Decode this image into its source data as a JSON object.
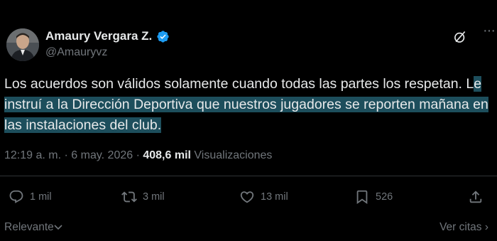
{
  "author": {
    "name": "Amaury Vergara Z.",
    "handle": "@Amauryvz"
  },
  "tweet": {
    "text_before": "Los acuerdos son válidos solamente cuando todas las partes los respetan. L",
    "text_highlight": "e instruí a la Dirección Deportiva que nuestros jugadores se reporten mañana en las instalaciones del club."
  },
  "meta": {
    "timestamp": "12:19 a. m. · 6 may. 2026 · ",
    "views_count": "408,6 mil",
    "views_label": "Visualizaciones"
  },
  "actions": {
    "replies": "1 mil",
    "reposts": "3 mil",
    "likes": "13 mil",
    "bookmarks": "526"
  },
  "footer": {
    "sort_label": "Relevante",
    "quotes_label": "Ver citas"
  },
  "colors": {
    "background": "#000000",
    "text": "#e7e9ea",
    "muted": "#71767b",
    "highlight": "#1d4e5c",
    "verified": "#1d9bf0"
  },
  "icons": [
    "grok-icon",
    "more-icon",
    "reply-icon",
    "repost-icon",
    "like-icon",
    "bookmark-icon",
    "share-icon",
    "chevron-down-icon"
  ]
}
